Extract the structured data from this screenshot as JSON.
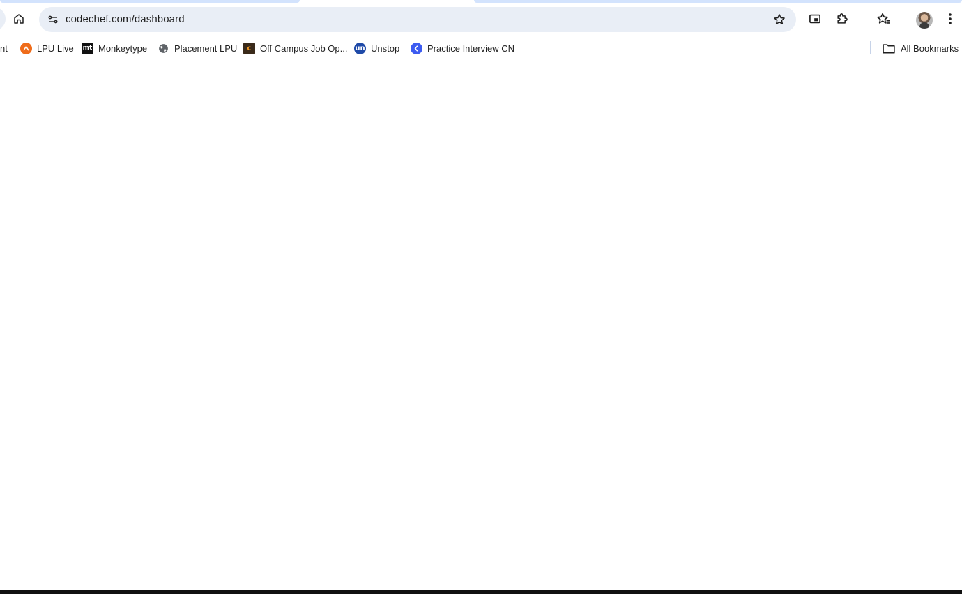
{
  "browser": {
    "address_bar": {
      "url": "codechef.com/dashboard"
    },
    "toolbar_icons": [
      "home-icon",
      "site-info-icon",
      "bookmark-star-icon",
      "picture-in-picture-icon",
      "extensions-icon",
      "reading-list-icon",
      "profile-avatar",
      "more-menu-icon"
    ]
  },
  "bookmarks_bar": {
    "items": [
      {
        "label": "nt",
        "icon": "truncated"
      },
      {
        "label": "LPU Live",
        "icon": "lpu-live-icon"
      },
      {
        "label": "Monkeytype",
        "icon": "monkeytype-icon"
      },
      {
        "label": "Placement LPU",
        "icon": "globe-icon"
      },
      {
        "label": "Off Campus Job Op...",
        "icon": "off-campus-icon"
      },
      {
        "label": "Unstop",
        "icon": "unstop-icon"
      },
      {
        "label": "Practice Interview CN",
        "icon": "coding-ninjas-icon"
      }
    ],
    "all_bookmarks_label": "All Bookmarks"
  },
  "favicon_text": {
    "monkeytype": "mt",
    "off_campus": "c",
    "unstop": "un"
  },
  "colors": {
    "omnibox_bg": "#e9eef6",
    "tab_accent": "#d3e3fd",
    "page_bg": "#ffffff"
  }
}
